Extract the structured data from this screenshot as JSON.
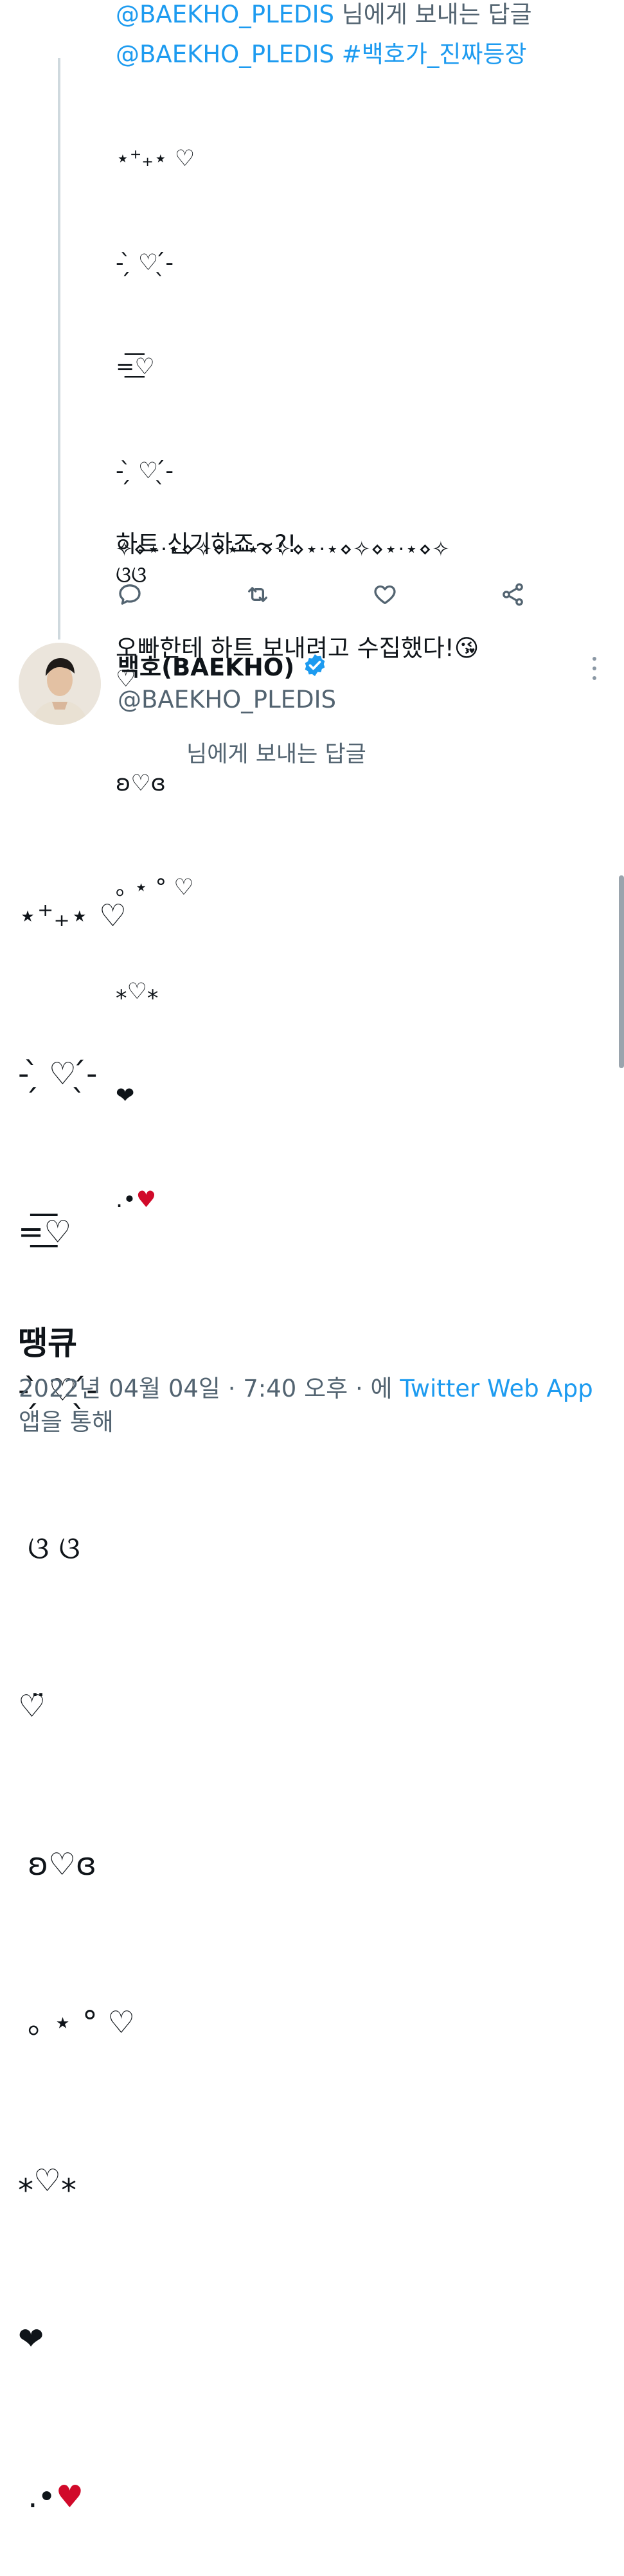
{
  "parent_tweet": {
    "reply_to_handle": "@BAEKHO_PLEDIS",
    "reply_to_suffix": " 님에게 보내는 답글",
    "mention": "@BAEKHO_PLEDIS",
    "hashtag": "#백호가_진짜등장",
    "heart_lines": [
      "⋆⁺₊⋆ ♡",
      "- ̗̀ ♡ ̖́-",
      "=͟͟͞♡",
      "- ̗̀ ♡ ̖́-",
      "ଓଓ",
      "♡̈",
      "ʚ♡ɞ",
      "｡ ⋆ ° ♡",
      "⁎♡⁎",
      "❤"
    ],
    "last_heart_dots": ".•",
    "last_heart": "♥",
    "text_line1": "하트 신기하죠~?!",
    "text_line2": "오빠한테 하트 보내려고 수집했다!",
    "text_emoji": "😘",
    "deco_line": "✧⋄⋆⋅⋆⋄✧⋄⋆⋅⋆⋄✧⋄⋆⋅⋆⋄✧⋄⋆⋅⋆⋄✧"
  },
  "actions": [
    {
      "name": "reply",
      "icon": "reply-icon"
    },
    {
      "name": "retweet",
      "icon": "retweet-icon"
    },
    {
      "name": "like",
      "icon": "heart-icon"
    },
    {
      "name": "share",
      "icon": "share-icon"
    }
  ],
  "main_tweet": {
    "display_name": "백호(BAEKHO)",
    "verified": true,
    "handle": "@BAEKHO_PLEDIS",
    "replying_text": "님에게 보내는 답글",
    "heart_lines": [
      "⋆⁺₊⋆ ♡",
      "- ̗̀ ♡ ̖́-",
      "=͟͟͞♡",
      "- ̗̀ ♡ ̖́-",
      " ଓ ଓ",
      "♡̈",
      " ʚ♡ɞ",
      " ｡ ⋆ ° ♡",
      "⁎♡⁎",
      "❤"
    ],
    "last_heart_dots": " .•",
    "last_heart": "♥",
    "text": "땡큐",
    "timestamp": "2022년 04월 04일 · 7:40 오후 · 에 ",
    "source": "Twitter Web App",
    "source_suffix": "앱을 통해"
  },
  "colors": {
    "link": "#1d9bf0",
    "secondary": "#536471",
    "verified": "#1d9bf0",
    "red_heart": "#d10a2a",
    "thread_line": "#cfd9de"
  }
}
